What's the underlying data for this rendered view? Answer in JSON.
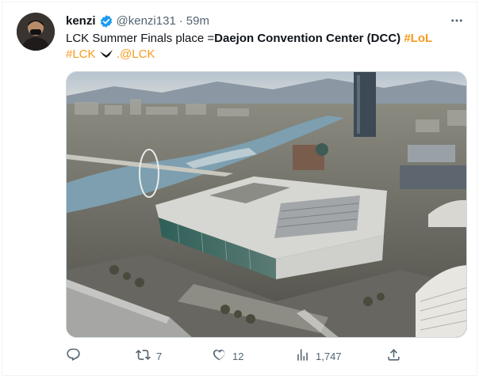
{
  "tweet": {
    "author": {
      "display_name": "kenzi",
      "handle": "@kenzi131",
      "verified": true,
      "avatar_icon": "profile-photo"
    },
    "separator": "·",
    "time": "59m",
    "more_icon": "more-horizontal-icon",
    "body": {
      "prefix": "LCK Summer Finals place =",
      "venue": "Daejon Convention Center (DCC)",
      "hashtag_lol": "#LoL",
      "hashtag_lck": "#LCK",
      "mention": ".@LCK"
    },
    "media": {
      "kind": "aerial-photo",
      "description_icon": "convention-center-photo"
    },
    "actions": {
      "reply": {
        "icon": "reply-icon",
        "count": ""
      },
      "retweet": {
        "icon": "retweet-icon",
        "count": "7"
      },
      "like": {
        "icon": "like-icon",
        "count": "12"
      },
      "views": {
        "icon": "views-icon",
        "count": "1,747"
      },
      "share": {
        "icon": "share-icon",
        "count": ""
      }
    }
  },
  "colors": {
    "hashtag": "#f79a1c",
    "verified": "#1d9bf0",
    "secondary_text": "#536471"
  }
}
